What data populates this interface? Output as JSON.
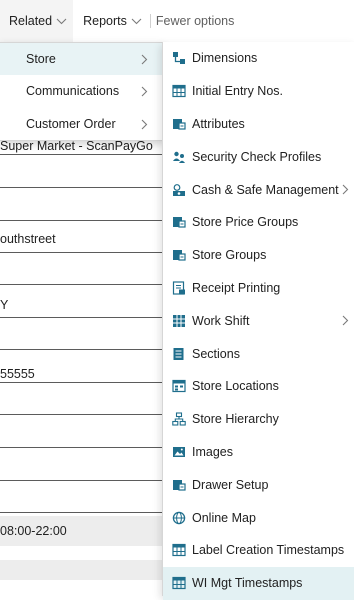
{
  "actionbar": {
    "related": "Related",
    "reports": "Reports",
    "fewer_options": "Fewer options"
  },
  "form": {
    "values": [
      "Super Market - ScanPayGo",
      "outhstreet",
      "Y",
      "55555",
      "08:00-22:00"
    ]
  },
  "related_menu": {
    "items": [
      {
        "label": "Store"
      },
      {
        "label": "Communications"
      },
      {
        "label": "Customer Order"
      }
    ]
  },
  "store_menu": {
    "items": [
      {
        "label": "Dimensions",
        "icon": "dimensions-icon"
      },
      {
        "label": "Initial Entry Nos.",
        "icon": "table-icon"
      },
      {
        "label": "Attributes",
        "icon": "attributes-icon"
      },
      {
        "label": "Security Check Profiles",
        "icon": "people-icon"
      },
      {
        "label": "Cash & Safe Management",
        "icon": "cash-icon"
      },
      {
        "label": "Store Price Groups",
        "icon": "attributes-icon"
      },
      {
        "label": "Store Groups",
        "icon": "attributes-icon"
      },
      {
        "label": "Receipt Printing",
        "icon": "receipt-icon"
      },
      {
        "label": "Work Shift",
        "icon": "grid-icon"
      },
      {
        "label": "Sections",
        "icon": "sections-icon"
      },
      {
        "label": "Store Locations",
        "icon": "locations-icon"
      },
      {
        "label": "Store Hierarchy",
        "icon": "hierarchy-icon"
      },
      {
        "label": "Images",
        "icon": "image-icon"
      },
      {
        "label": "Drawer Setup",
        "icon": "attributes-icon"
      },
      {
        "label": "Online Map",
        "icon": "globe-icon"
      },
      {
        "label": "Label Creation Timestamps",
        "icon": "table-icon"
      },
      {
        "label": "WI Mgt Timestamps",
        "icon": "table-icon"
      }
    ]
  },
  "colors": {
    "accent": "#1f6e8c",
    "selected_bg": "#e3f1f3",
    "grey_field": "#ededed"
  }
}
